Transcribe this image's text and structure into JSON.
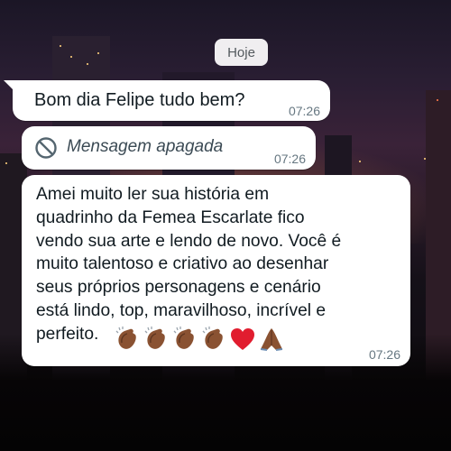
{
  "chat": {
    "date_separator": "Hoje",
    "messages": [
      {
        "text": "Bom dia Felipe tudo bem?",
        "time": "07:26"
      },
      {
        "text": "Mensagem apagada",
        "time": "07:26",
        "icon": "deleted-message-icon"
      },
      {
        "text": "Amei muito ler sua história em\nquadrinho da Femea Escarlate fico\nvendo sua arte e lendo de novo. Você é\nmuito talentoso e criativo ao desenhar\nseus próprios personagens e cenário\nestá lindo, top, maravilhoso, incrível e\nperfeito.",
        "time": "07:26",
        "emojis": [
          "clapping-hands",
          "clapping-hands",
          "clapping-hands",
          "clapping-hands",
          "red-heart",
          "folded-hands"
        ]
      }
    ]
  },
  "colors": {
    "bubble": "#ffffff",
    "timestamp": "#667781",
    "heart": "#e11d2f",
    "skin": "#8a5232"
  }
}
